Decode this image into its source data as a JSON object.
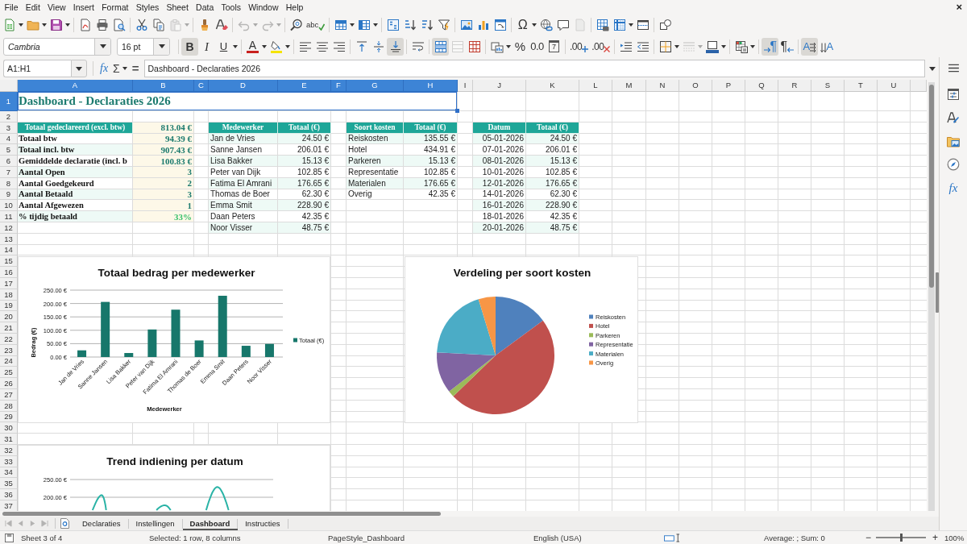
{
  "menu_bar": {
    "items": [
      "File",
      "Edit",
      "View",
      "Insert",
      "Format",
      "Styles",
      "Sheet",
      "Data",
      "Tools",
      "Window",
      "Help"
    ],
    "close": "×"
  },
  "standard_toolbar": {
    "groups": [
      [
        {
          "kind": "new",
          "dropdown": true,
          "disabled": false
        },
        {
          "kind": "open",
          "dropdown": true,
          "disabled": false
        },
        {
          "kind": "save",
          "dropdown": true,
          "disabled": false
        }
      ],
      [
        {
          "kind": "pdf",
          "dropdown": false,
          "disabled": false
        },
        {
          "kind": "print",
          "dropdown": false,
          "disabled": false
        },
        {
          "kind": "preview",
          "dropdown": false,
          "disabled": false
        }
      ],
      [
        {
          "kind": "cut",
          "dropdown": false,
          "disabled": false
        },
        {
          "kind": "copy",
          "dropdown": false,
          "disabled": false
        },
        {
          "kind": "paste",
          "dropdown": true,
          "disabled": true
        }
      ],
      [
        {
          "kind": "clone",
          "dropdown": false,
          "disabled": false
        },
        {
          "kind": "clear",
          "dropdown": false,
          "disabled": false
        }
      ],
      [
        {
          "kind": "undo",
          "dropdown": true,
          "disabled": true
        },
        {
          "kind": "redo",
          "dropdown": true,
          "disabled": true
        }
      ],
      [
        {
          "kind": "find",
          "dropdown": false,
          "disabled": false
        },
        {
          "kind": "spelling",
          "glyph": "abc",
          "dropdown": false,
          "disabled": false
        }
      ],
      [
        {
          "kind": "rows",
          "dropdown": true,
          "disabled": false
        },
        {
          "kind": "columns",
          "dropdown": true,
          "disabled": false
        }
      ],
      [
        {
          "kind": "sort",
          "dropdown": false,
          "disabled": false
        },
        {
          "kind": "sortasc",
          "dropdown": false,
          "disabled": false
        },
        {
          "kind": "sortdesc",
          "dropdown": false,
          "disabled": false
        },
        {
          "kind": "filter",
          "dropdown": false,
          "disabled": false
        }
      ],
      [
        {
          "kind": "image",
          "dropdown": false,
          "disabled": false
        },
        {
          "kind": "chart",
          "dropdown": false,
          "disabled": false
        },
        {
          "kind": "pivot",
          "dropdown": false,
          "disabled": false
        }
      ],
      [
        {
          "kind": "symbol",
          "glyph": "Ω",
          "dropdown": true,
          "disabled": false
        },
        {
          "kind": "link",
          "dropdown": false,
          "disabled": false
        },
        {
          "kind": "comment",
          "dropdown": false,
          "disabled": false
        },
        {
          "kind": "headers",
          "dropdown": false,
          "disabled": true
        }
      ],
      [
        {
          "kind": "printarea",
          "dropdown": false,
          "disabled": false
        },
        {
          "kind": "freeze",
          "dropdown": true,
          "disabled": false
        },
        {
          "kind": "split",
          "dropdown": false,
          "disabled": false
        }
      ],
      [
        {
          "kind": "draw",
          "dropdown": false,
          "disabled": false
        }
      ]
    ]
  },
  "formatting_toolbar": {
    "font_name": "Cambria",
    "font_size": "16 pt",
    "groups": [
      [
        {
          "kind": "bold",
          "glyph": "B",
          "on": true,
          "disabled": false,
          "dropdown": false
        },
        {
          "kind": "italic",
          "glyph": "I",
          "on": false,
          "disabled": false,
          "dropdown": false
        },
        {
          "kind": "underline",
          "glyph": "U",
          "on": false,
          "disabled": false,
          "dropdown": true
        }
      ],
      [
        {
          "kind": "fontcolor",
          "glyph": "A",
          "on": false,
          "disabled": false,
          "dropdown": true
        },
        {
          "kind": "highlight",
          "on": false,
          "disabled": false,
          "dropdown": true
        }
      ],
      [
        {
          "kind": "alignleft",
          "on": false,
          "disabled": false,
          "dropdown": false
        },
        {
          "kind": "aligncenter",
          "on": false,
          "disabled": false,
          "dropdown": false
        },
        {
          "kind": "alignright",
          "on": false,
          "disabled": false,
          "dropdown": false
        }
      ],
      [
        {
          "kind": "aligntop",
          "on": false,
          "disabled": false,
          "dropdown": false
        },
        {
          "kind": "alignmiddle",
          "on": false,
          "disabled": false,
          "dropdown": false
        },
        {
          "kind": "alignbottom",
          "on": true,
          "disabled": false,
          "dropdown": false
        }
      ],
      [
        {
          "kind": "wrap",
          "on": false,
          "disabled": false,
          "dropdown": false
        }
      ],
      [
        {
          "kind": "mergecenter",
          "on": true,
          "disabled": false,
          "dropdown": false
        },
        {
          "kind": "merge",
          "on": false,
          "disabled": true,
          "dropdown": false
        },
        {
          "kind": "unmerge",
          "on": false,
          "disabled": false,
          "dropdown": false
        }
      ],
      [
        {
          "kind": "numformat",
          "on": false,
          "disabled": false,
          "dropdown": true
        },
        {
          "kind": "percent",
          "glyph": "%",
          "on": false,
          "disabled": false,
          "dropdown": false
        },
        {
          "kind": "number",
          "glyph": "0.0",
          "on": false,
          "disabled": false,
          "dropdown": false
        },
        {
          "kind": "date",
          "glyph": "7",
          "on": false,
          "disabled": false,
          "dropdown": false
        }
      ],
      [
        {
          "kind": "adddecimal",
          "glyph": ".00",
          "on": false,
          "disabled": false,
          "dropdown": false
        },
        {
          "kind": "deldecimal",
          "glyph": ".00",
          "on": false,
          "disabled": false,
          "dropdown": false
        }
      ],
      [
        {
          "kind": "indent",
          "on": false,
          "disabled": false,
          "dropdown": false
        },
        {
          "kind": "outdent",
          "on": false,
          "disabled": false,
          "dropdown": false
        }
      ],
      [
        {
          "kind": "borders",
          "on": false,
          "disabled": false,
          "dropdown": true
        },
        {
          "kind": "borderstyle",
          "on": false,
          "disabled": true,
          "dropdown": true
        },
        {
          "kind": "bordercolor",
          "on": false,
          "disabled": false,
          "dropdown": true
        }
      ],
      [
        {
          "kind": "conditional",
          "on": false,
          "disabled": false,
          "dropdown": true
        }
      ],
      [
        {
          "kind": "ltr",
          "glyph": "¶",
          "on": true,
          "disabled": false,
          "dropdown": false
        },
        {
          "kind": "rtl",
          "glyph": "¶",
          "on": false,
          "disabled": false,
          "dropdown": false
        }
      ],
      [
        {
          "kind": "horizontal",
          "glyph": "A",
          "on": true,
          "disabled": false,
          "dropdown": false
        },
        {
          "kind": "vertical",
          "glyph": "A",
          "on": false,
          "disabled": false,
          "dropdown": false
        }
      ]
    ]
  },
  "formula_bar": {
    "name_box": "A1:H1",
    "wizard": "fx",
    "sum": "Σ",
    "equals": "=",
    "content": "Dashboard - Declaraties 2026"
  },
  "sidebar": {
    "items": [
      {
        "kind": "properties"
      },
      {
        "kind": "styles"
      },
      {
        "kind": "gallery"
      },
      {
        "kind": "navigator"
      },
      {
        "kind": "functions",
        "glyph": "fx"
      }
    ]
  },
  "sheet": {
    "columns": [
      {
        "label": "A",
        "selected": true
      },
      {
        "label": "B",
        "selected": true
      },
      {
        "label": "C",
        "selected": true
      },
      {
        "label": "D",
        "selected": true
      },
      {
        "label": "E",
        "selected": true
      },
      {
        "label": "F",
        "selected": true
      },
      {
        "label": "G",
        "selected": true
      },
      {
        "label": "H",
        "selected": true
      },
      {
        "label": "I",
        "selected": false
      },
      {
        "label": "J",
        "selected": false
      },
      {
        "label": "K",
        "selected": false
      },
      {
        "label": "L",
        "selected": false
      },
      {
        "label": "M",
        "selected": false
      },
      {
        "label": "N",
        "selected": false
      },
      {
        "label": "O",
        "selected": false
      },
      {
        "label": "P",
        "selected": false
      },
      {
        "label": "Q",
        "selected": false
      },
      {
        "label": "R",
        "selected": false
      },
      {
        "label": "S",
        "selected": false
      },
      {
        "label": "T",
        "selected": false
      },
      {
        "label": "U",
        "selected": false
      }
    ],
    "rows": [
      {
        "label": "1",
        "selected": true
      },
      {
        "label": "2",
        "selected": false
      },
      {
        "label": "3",
        "selected": false
      },
      {
        "label": "4",
        "selected": false
      },
      {
        "label": "5",
        "selected": false
      },
      {
        "label": "6",
        "selected": false
      },
      {
        "label": "7",
        "selected": false
      },
      {
        "label": "8",
        "selected": false
      },
      {
        "label": "9",
        "selected": false
      },
      {
        "label": "10",
        "selected": false
      },
      {
        "label": "11",
        "selected": false
      },
      {
        "label": "12",
        "selected": false
      },
      {
        "label": "13",
        "selected": false
      },
      {
        "label": "14",
        "selected": false
      },
      {
        "label": "15",
        "selected": false
      },
      {
        "label": "16",
        "selected": false
      },
      {
        "label": "17",
        "selected": false
      },
      {
        "label": "18",
        "selected": false
      },
      {
        "label": "19",
        "selected": false
      },
      {
        "label": "20",
        "selected": false
      },
      {
        "label": "21",
        "selected": false
      },
      {
        "label": "22",
        "selected": false
      },
      {
        "label": "23",
        "selected": false
      },
      {
        "label": "24",
        "selected": false
      },
      {
        "label": "25",
        "selected": false
      },
      {
        "label": "26",
        "selected": false
      },
      {
        "label": "27",
        "selected": false
      },
      {
        "label": "28",
        "selected": false
      },
      {
        "label": "29",
        "selected": false
      },
      {
        "label": "30",
        "selected": false
      },
      {
        "label": "31",
        "selected": false
      },
      {
        "label": "32",
        "selected": false
      },
      {
        "label": "33",
        "selected": false
      },
      {
        "label": "34",
        "selected": false
      },
      {
        "label": "35",
        "selected": false
      },
      {
        "label": "36",
        "selected": false
      },
      {
        "label": "37",
        "selected": false
      }
    ],
    "title": {
      "text": "Dashboard - Declaraties 2026",
      "selected": true
    },
    "summary": [
      {
        "kind": "header",
        "label": "Totaal gedeclareerd (excl. btw)",
        "value": "813.04 €"
      },
      {
        "kind": "metric",
        "label": "Totaal btw",
        "value": "94.39 €"
      },
      {
        "kind": "metric",
        "label": "Totaal incl. btw",
        "value": "907.43 €"
      },
      {
        "kind": "metric",
        "label": "Gemiddelde declaratie (incl. b",
        "value": "100.83 €"
      },
      {
        "kind": "metric",
        "label": "Aantal Open",
        "value": "3"
      },
      {
        "kind": "metric",
        "label": "Aantal Goedgekeurd",
        "value": "2"
      },
      {
        "kind": "metric",
        "label": "Aantal Betaald",
        "value": "3"
      },
      {
        "kind": "metric",
        "label": "Aantal Afgewezen",
        "value": "1"
      },
      {
        "kind": "rate",
        "label": "% tijdig betaald",
        "value": "33%"
      }
    ],
    "tables": [
      {
        "kind": "names",
        "columns": [
          "Medewerker",
          "Totaal (€)"
        ],
        "rows": [
          [
            "Jan de Vries",
            "24.50 €"
          ],
          [
            "Sanne Jansen",
            "206.01 €"
          ],
          [
            "Lisa Bakker",
            "15.13 €"
          ],
          [
            "Peter van Dijk",
            "102.85 €"
          ],
          [
            "Fatima El Amrani",
            "176.65 €"
          ],
          [
            "Thomas de Boer",
            "62.30 €"
          ],
          [
            "Emma Smit",
            "228.90 €"
          ],
          [
            "Daan Peters",
            "42.35 €"
          ],
          [
            "Noor Visser",
            "48.75 €"
          ]
        ]
      },
      {
        "kind": "names",
        "columns": [
          "Soort kosten",
          "Totaal (€)"
        ],
        "rows": [
          [
            "Reiskosten",
            "135.55 €"
          ],
          [
            "Hotel",
            "434.91 €"
          ],
          [
            "Parkeren",
            "15.13 €"
          ],
          [
            "Representatie",
            "102.85 €"
          ],
          [
            "Materialen",
            "176.65 €"
          ],
          [
            "Overig",
            "42.35 €"
          ]
        ]
      },
      {
        "kind": "dates",
        "columns": [
          "Datum",
          "Totaal (€)"
        ],
        "rows": [
          [
            "05-01-2026",
            "24.50 €"
          ],
          [
            "07-01-2026",
            "206.01 €"
          ],
          [
            "08-01-2026",
            "15.13 €"
          ],
          [
            "10-01-2026",
            "102.85 €"
          ],
          [
            "12-01-2026",
            "176.65 €"
          ],
          [
            "14-01-2026",
            "62.30 €"
          ],
          [
            "16-01-2026",
            "228.90 €"
          ],
          [
            "18-01-2026",
            "42.35 €"
          ],
          [
            "20-01-2026",
            "48.75 €"
          ]
        ]
      }
    ]
  },
  "charts": [
    {
      "chart_data": {
        "type": "bar",
        "title": "Totaal bedrag per medewerker",
        "xlabel": "Medewerker",
        "ylabel": "Bedrag (€)",
        "categories": [
          "Jan de Vries",
          "Sanne Jansen",
          "Lisa Bakker",
          "Peter van Dijk",
          "Fatima El Amrani",
          "Thomas de Boer",
          "Emma Smit",
          "Daan Peters",
          "Noor Visser"
        ],
        "series": [
          {
            "name": "Totaal (€)",
            "color": "#17776b",
            "values": [
              25,
              206,
              15,
              103,
              177,
              62,
              229,
              42,
              49
            ]
          }
        ],
        "ylim": [
          0,
          250
        ],
        "yticks": [
          {
            "value": 0,
            "label": "0.00 €"
          },
          {
            "value": 50,
            "label": "50.00 €"
          },
          {
            "value": 100,
            "label": "100.00 €"
          },
          {
            "value": 150,
            "label": "150.00 €"
          },
          {
            "value": 200,
            "label": "200.00 €"
          },
          {
            "value": 250,
            "label": "250.00 €"
          }
        ],
        "grid": true,
        "legend": true
      }
    },
    {
      "chart_data": {
        "type": "pie",
        "title": "Verdeling per soort kosten",
        "categories": [
          "Reiskosten",
          "Hotel",
          "Parkeren",
          "Representatie",
          "Materialen",
          "Overig"
        ],
        "values": [
          14.9,
          47.9,
          1.7,
          11.3,
          19.5,
          4.7
        ],
        "colors": [
          "#4f81bd",
          "#c0504d",
          "#9bbb59",
          "#8064a2",
          "#4bacc6",
          "#f79646"
        ],
        "legend": true
      }
    }
  ],
  "trend_chart": {
    "title": "Trend indiening per datum",
    "tick_labels": [
      "250.00 €",
      "200.00 €"
    ]
  },
  "sheet_tabs": {
    "nav_disabled": true,
    "tabs": [
      {
        "label": "Declaraties",
        "selected": false
      },
      {
        "label": "Instellingen",
        "selected": false
      },
      {
        "label": "Dashboard",
        "selected": true
      },
      {
        "label": "Instructies",
        "selected": false
      }
    ]
  },
  "status_bar": {
    "sheet": "Sheet 3 of 4",
    "selection": "Selected: 1 row, 8 columns",
    "page_style": "PageStyle_Dashboard",
    "language": "English (USA)",
    "summary": "Average: ; Sum: 0",
    "zoom": {
      "out": "−",
      "in": "+",
      "level": 0.5,
      "label": "100%"
    }
  }
}
